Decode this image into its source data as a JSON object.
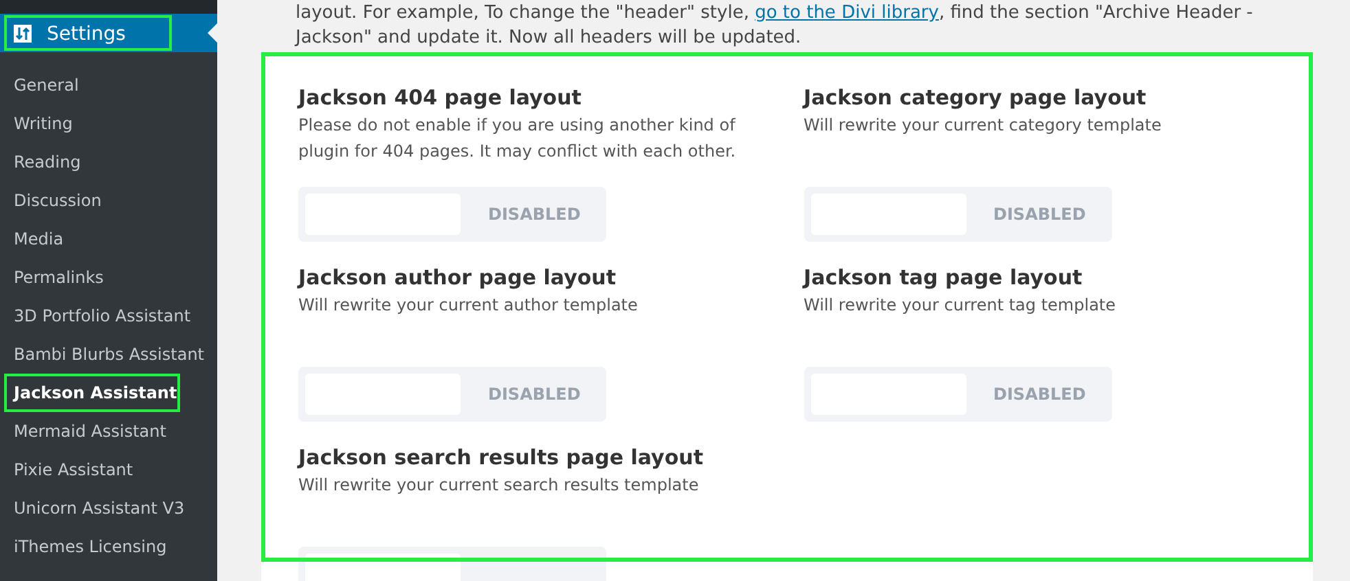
{
  "sidebar": {
    "menu": {
      "label": "Settings",
      "selected": true
    },
    "items": [
      {
        "label": "General",
        "selected": false
      },
      {
        "label": "Writing",
        "selected": false
      },
      {
        "label": "Reading",
        "selected": false
      },
      {
        "label": "Discussion",
        "selected": false
      },
      {
        "label": "Media",
        "selected": false
      },
      {
        "label": "Permalinks",
        "selected": false
      },
      {
        "label": "3D Portfolio Assistant",
        "selected": false
      },
      {
        "label": "Bambi Blurbs Assistant",
        "selected": false
      },
      {
        "label": "Jackson Assistant",
        "selected": true
      },
      {
        "label": "Mermaid Assistant",
        "selected": false
      },
      {
        "label": "Pixie Assistant",
        "selected": false
      },
      {
        "label": "Unicorn Assistant V3",
        "selected": false
      },
      {
        "label": "iThemes Licensing",
        "selected": false
      }
    ]
  },
  "intro": {
    "line_1_before": "layout. For example, To change the \"header\" style, ",
    "link": "go to the Divi library",
    "line_1_after": ", find the section \"Archive Header -",
    "line_2": "Jackson\" and update it. Now all headers will be updated."
  },
  "settings": [
    {
      "title": "Jackson 404 page layout",
      "description": "Please do not enable if you are using another kind of plugin for 404 pages. It may conflict with each other.",
      "toggle": {
        "on": false,
        "label": "DISABLED"
      }
    },
    {
      "title": "Jackson category page layout",
      "description": "Will rewrite your current category template",
      "toggle": {
        "on": false,
        "label": "DISABLED"
      }
    },
    {
      "title": "Jackson author page layout",
      "description": "Will rewrite your current author template",
      "toggle": {
        "on": false,
        "label": "DISABLED"
      }
    },
    {
      "title": "Jackson tag page layout",
      "description": "Will rewrite your current tag template",
      "toggle": {
        "on": false,
        "label": "DISABLED"
      }
    },
    {
      "title": "Jackson search results page layout",
      "description": "Will rewrite your current search results template",
      "toggle": {
        "on": false
      }
    }
  ]
}
